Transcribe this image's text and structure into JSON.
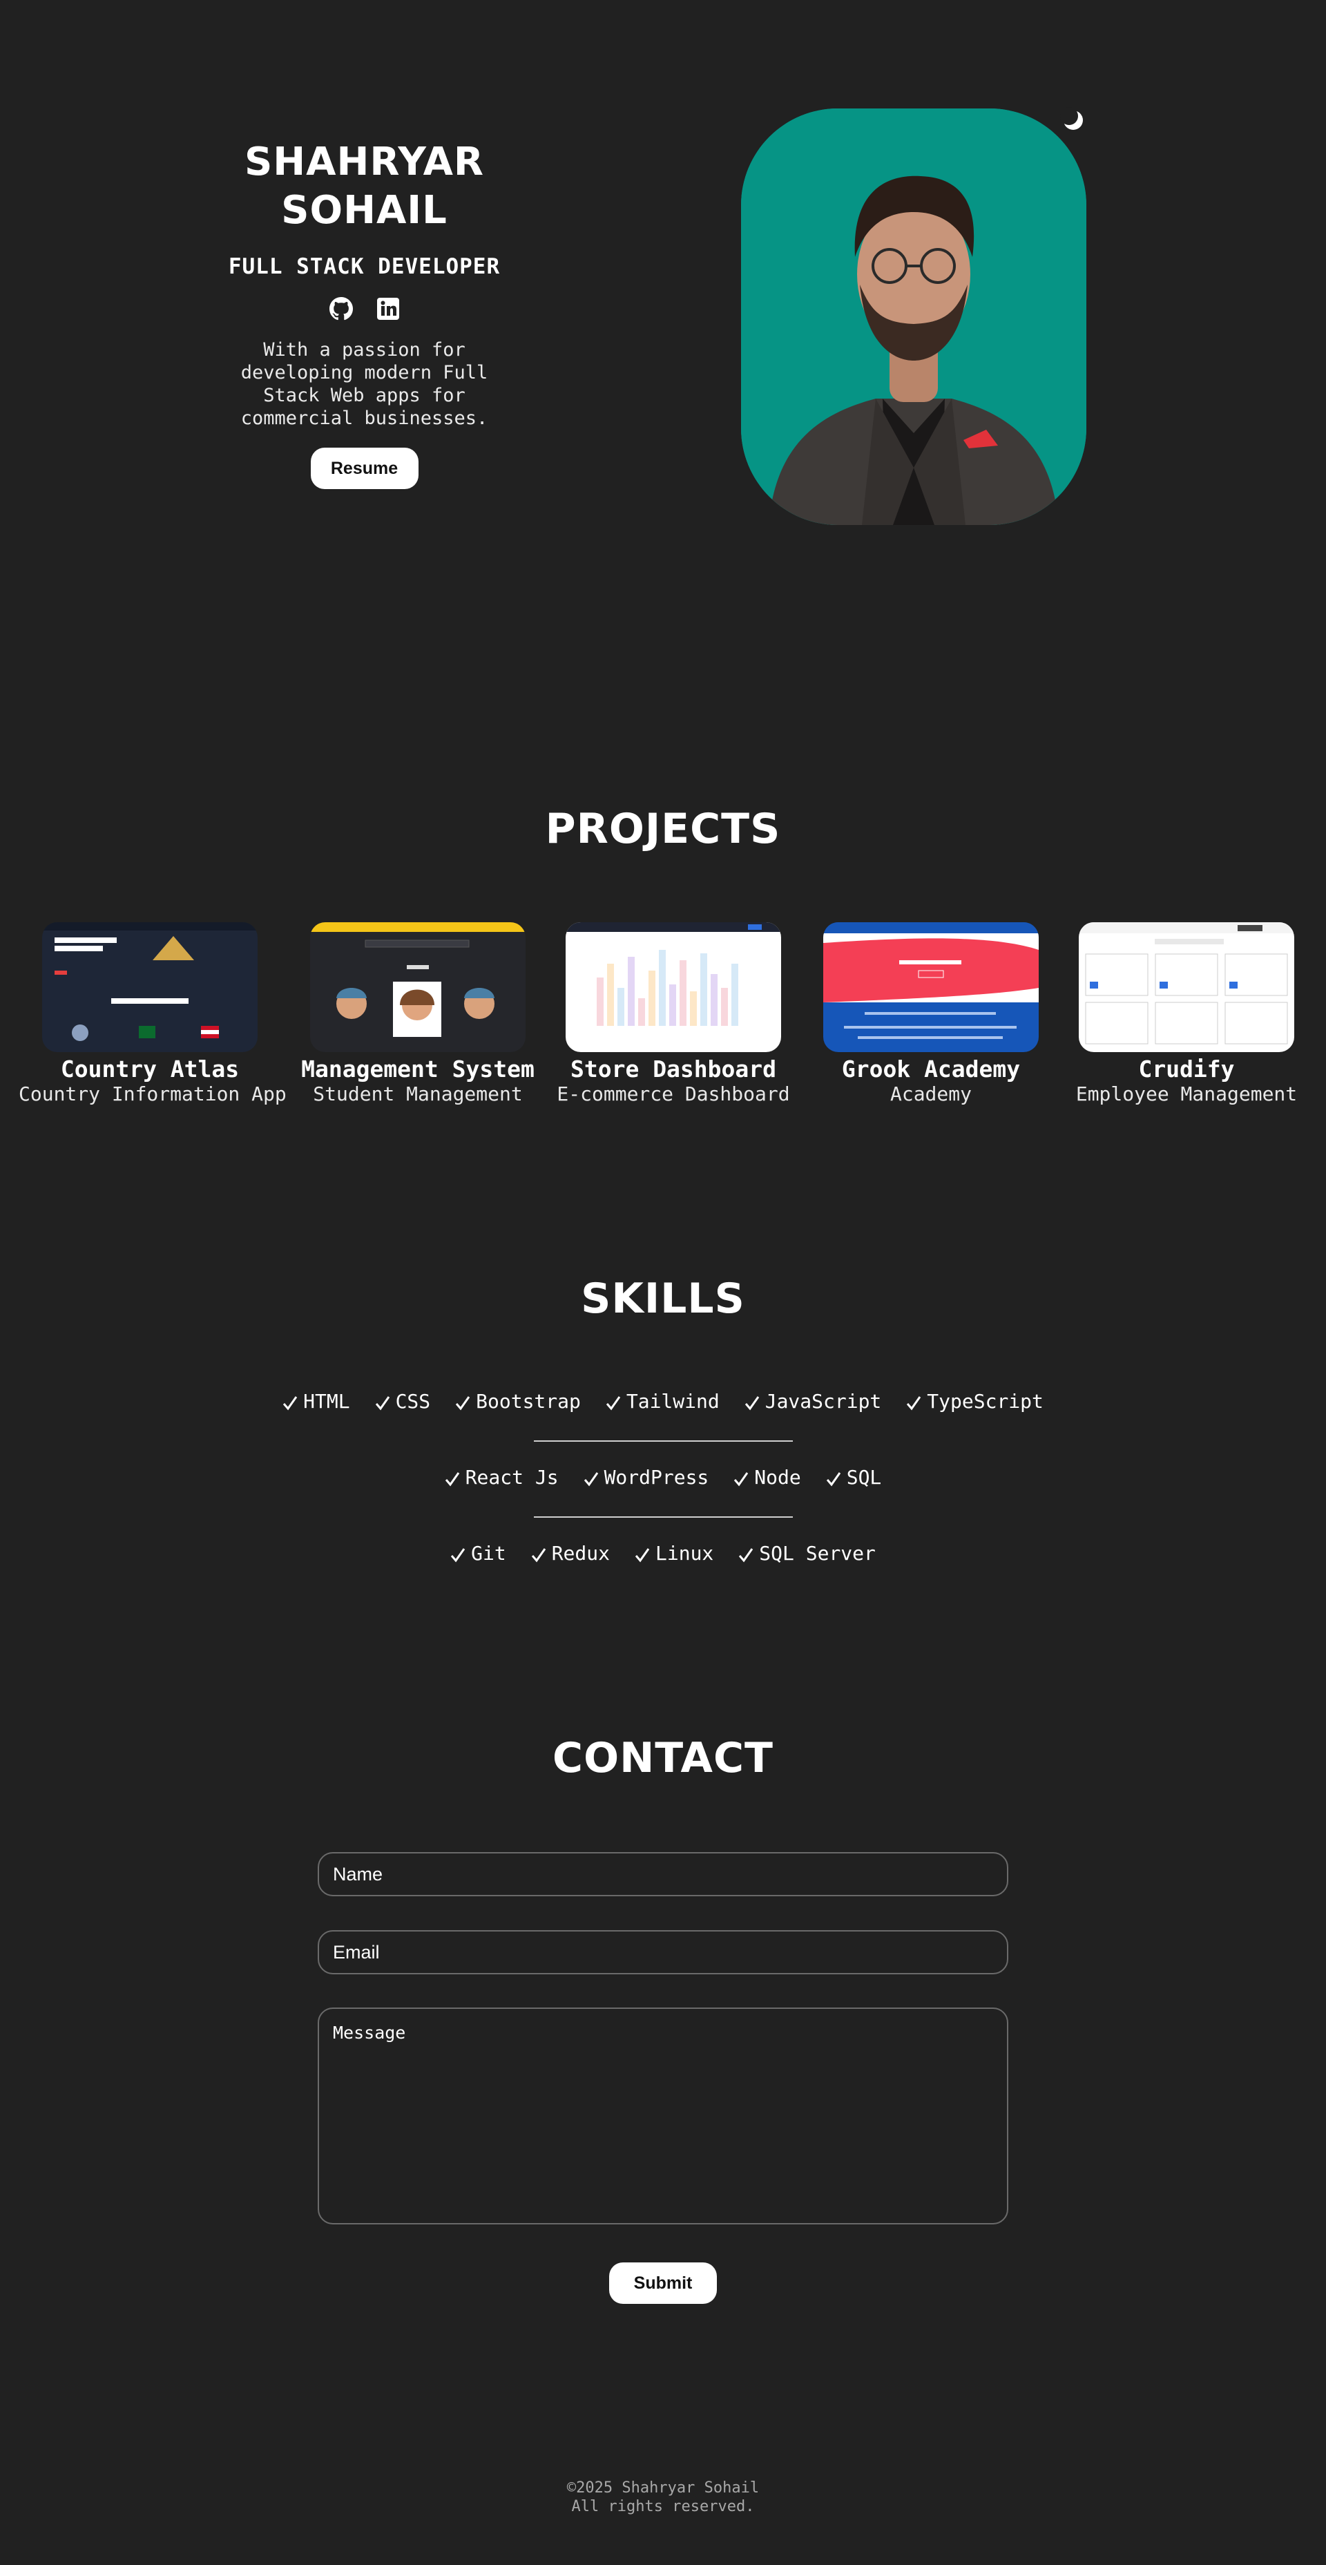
{
  "hero": {
    "name_line1": "SHAHRYAR",
    "name_line2": "SOHAIL",
    "role": "FULL STACK DEVELOPER",
    "bio": "With a passion for developing modern Full Stack Web apps for commercial businesses.",
    "resume_label": "Resume",
    "social_icons": [
      "github-icon",
      "linkedin-icon"
    ],
    "theme_icon": "moon-icon",
    "portrait_bg": "#069485"
  },
  "projects": {
    "title": "PROJECTS",
    "items": [
      {
        "name": "Country Atlas",
        "subtitle": "Country Information App"
      },
      {
        "name": "Management System",
        "subtitle": "Student Management"
      },
      {
        "name": "Store Dashboard",
        "subtitle": "E-commerce Dashboard"
      },
      {
        "name": "Grook Academy",
        "subtitle": "Academy"
      },
      {
        "name": "Crudify",
        "subtitle": "Employee Management"
      }
    ]
  },
  "skills": {
    "title": "SKILLS",
    "rows": [
      [
        "HTML",
        "CSS",
        "Bootstrap",
        "Tailwind",
        "JavaScript",
        "TypeScript"
      ],
      [
        "React Js",
        "WordPress",
        "Node",
        "SQL"
      ],
      [
        "Git",
        "Redux",
        "Linux",
        "SQL Server"
      ]
    ]
  },
  "contact": {
    "title": "CONTACT",
    "name_placeholder": "Name",
    "email_placeholder": "Email",
    "message_placeholder": "Message",
    "submit_label": "Submit"
  },
  "footer": {
    "line1": "©2025 Shahryar Sohail",
    "line2": "All rights reserved."
  },
  "colors": {
    "background": "#212121",
    "accent_teal": "#069485",
    "text": "#ffffff"
  }
}
